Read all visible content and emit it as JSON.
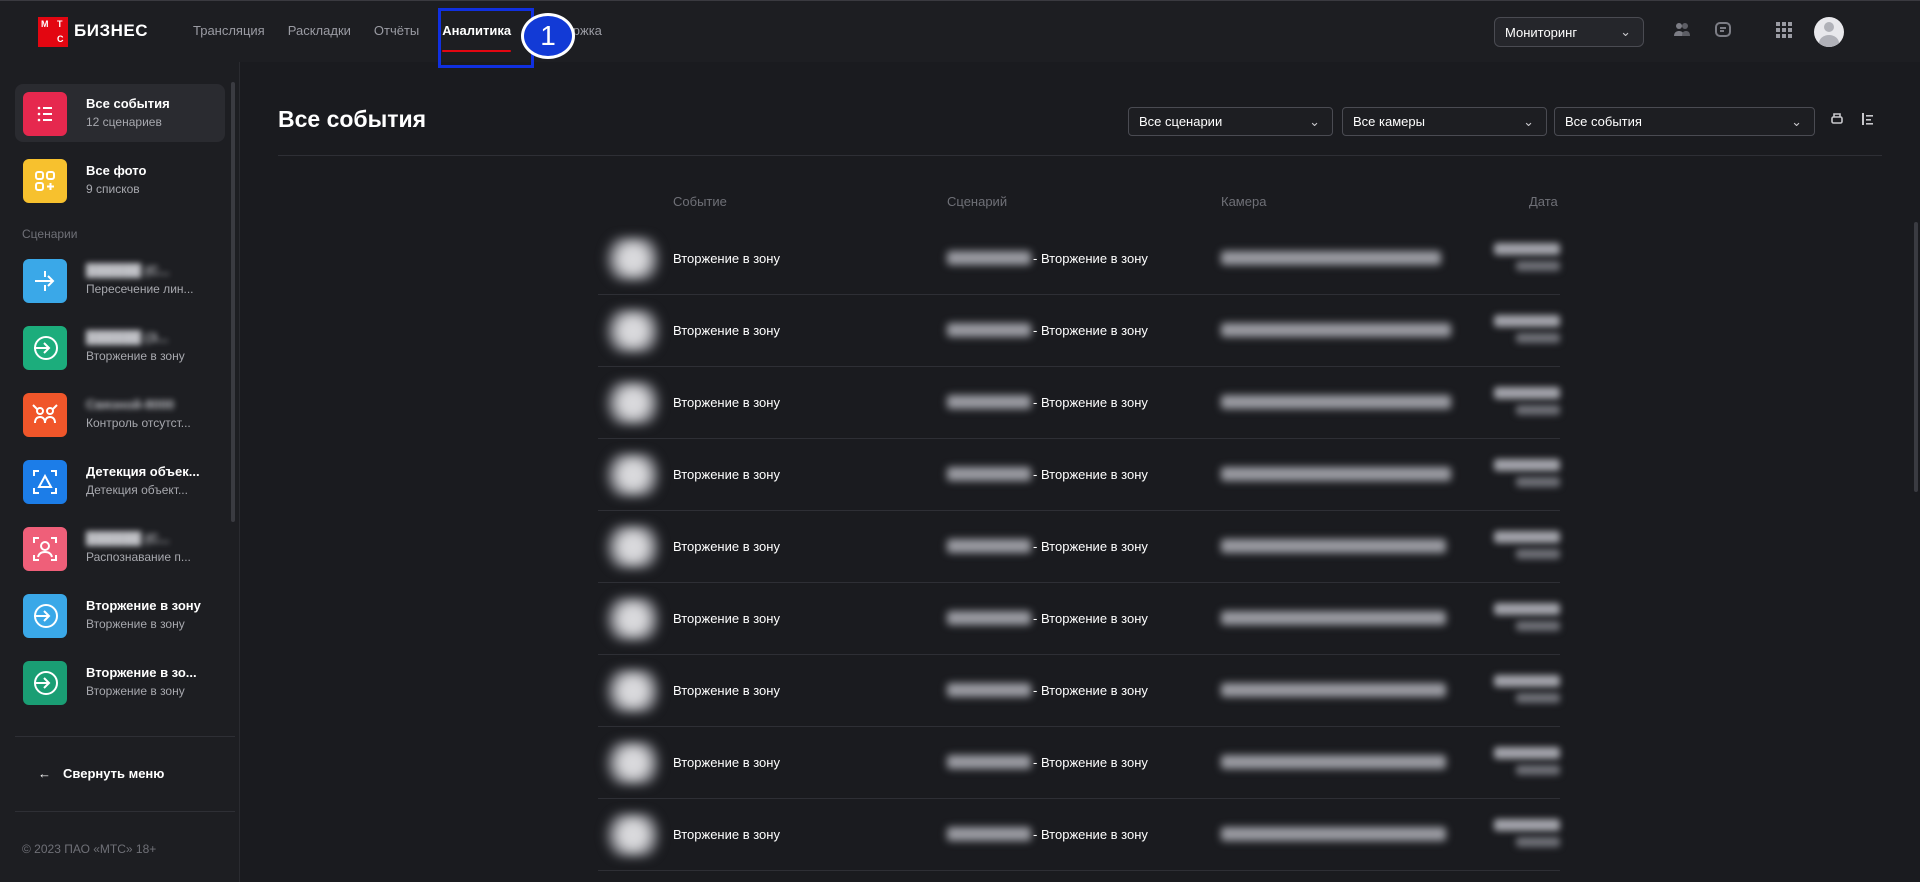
{
  "header": {
    "logo_letters": [
      "М",
      "Т",
      "С"
    ],
    "logo_text": "БИЗНЕС",
    "nav": [
      "Трансляция",
      "Раскладки",
      "Отчёты",
      "Аналитика",
      "Поддержка"
    ],
    "active_nav": "Аналитика",
    "annotation_number": "1",
    "monitoring_select": "Мониторинг"
  },
  "sidebar": {
    "top_items": [
      {
        "title": "Все события",
        "subtitle": "12 сценариев",
        "color": "#e6284e",
        "icon": "list-icon"
      },
      {
        "title": "Все фото",
        "subtitle": "9 списков",
        "color": "#f7c12e",
        "icon": "grid-plus-icon"
      }
    ],
    "section_label": "Сценарии",
    "scenarios": [
      {
        "title": "██████ (С...",
        "subtitle": "Пересечение лин...",
        "color": "#3aa8e8",
        "icon": "arrow-line-icon",
        "blurred": true
      },
      {
        "title": "██████ (З...",
        "subtitle": "Вторжение в зону",
        "color": "#1cad7c",
        "icon": "enter-circle-icon",
        "blurred": true
      },
      {
        "title": "Связной-8000",
        "subtitle": "Контроль отсутст...",
        "color": "#f0562a",
        "icon": "people-icon",
        "blurred": true
      },
      {
        "title": "Детекция объек...",
        "subtitle": "Детекция объект...",
        "color": "#1c7de8",
        "icon": "triangle-focus-icon",
        "blurred": false
      },
      {
        "title": "██████ (С...",
        "subtitle": "Распознавание п...",
        "color": "#ef5f79",
        "icon": "face-scan-icon",
        "blurred": true
      },
      {
        "title": "Вторжение в зону",
        "subtitle": "Вторжение в зону",
        "color": "#3aa8e8",
        "icon": "enter-circle-icon",
        "blurred": false
      },
      {
        "title": "Вторжение в зо...",
        "subtitle": "Вторжение в зону",
        "color": "#1a9e74",
        "icon": "enter-circle-icon",
        "blurred": false
      }
    ],
    "collapse_label": "Свернуть меню",
    "copyright": "© 2023 ПАО «МТС» 18+"
  },
  "main": {
    "title": "Все события",
    "filters": [
      "Все сценарии",
      "Все камеры",
      "Все события"
    ],
    "columns": [
      "Событие",
      "Сценарий",
      "Камера",
      "Дата"
    ],
    "rows": [
      {
        "event": "Вторжение в зону",
        "scenario_suffix": "- Вторжение в зону"
      },
      {
        "event": "Вторжение в зону",
        "scenario_suffix": "- Вторжение в зону"
      },
      {
        "event": "Вторжение в зону",
        "scenario_suffix": "- Вторжение в зону"
      },
      {
        "event": "Вторжение в зону",
        "scenario_suffix": "- Вторжение в зону"
      },
      {
        "event": "Вторжение в зону",
        "scenario_suffix": "- Вторжение в зону"
      },
      {
        "event": "Вторжение в зону",
        "scenario_suffix": "- Вторжение в зону"
      },
      {
        "event": "Вторжение в зону",
        "scenario_suffix": "- Вторжение в зону"
      },
      {
        "event": "Вторжение в зону",
        "scenario_suffix": "- Вторжение в зону"
      },
      {
        "event": "Вторжение в зону",
        "scenario_suffix": "- Вторжение в зону"
      }
    ]
  },
  "colors": {
    "accent": "#e30611",
    "annotation": "#123ad6"
  }
}
